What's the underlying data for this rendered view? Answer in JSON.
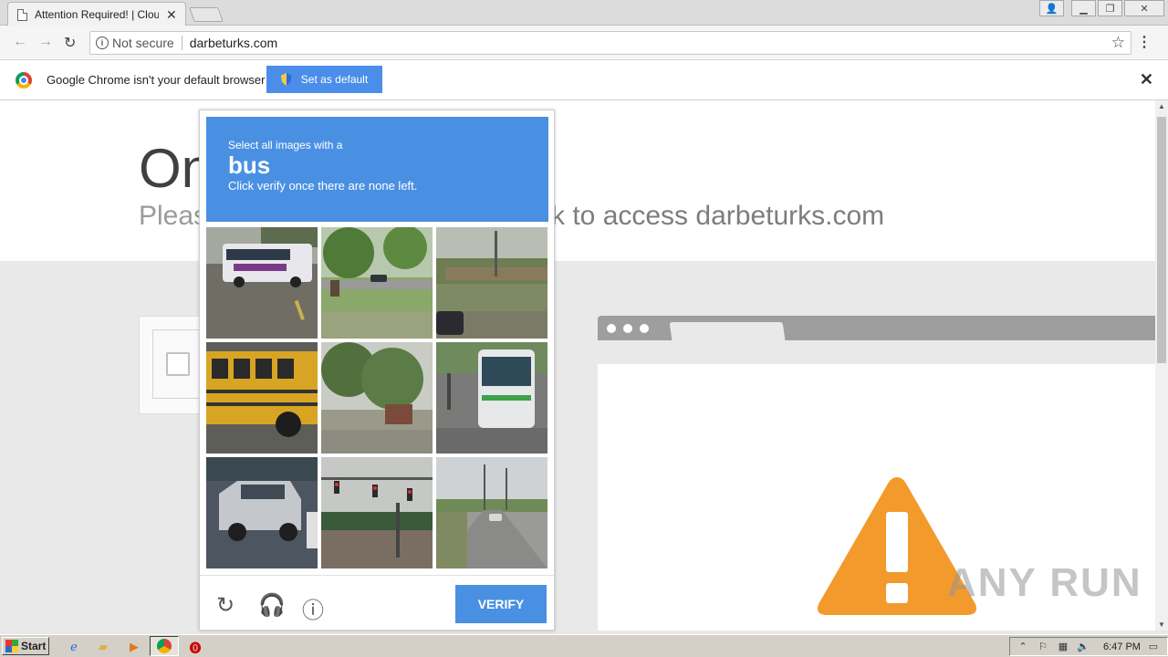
{
  "browser": {
    "tab_title": "Attention Required! | Cloudf",
    "security_label": "Not secure",
    "url": "darbeturks.com"
  },
  "infobar": {
    "message": "Google Chrome isn't your default browser",
    "button_label": "Set as default"
  },
  "page": {
    "heading": "On",
    "subheading_left": "Pleas",
    "subheading_right": "k to access darbeturks.com"
  },
  "captcha": {
    "instruction_line1": "Select all images with a",
    "target_word": "bus",
    "instruction_line3": "Click verify once there are none left.",
    "verify_label": "VERIFY",
    "tiles": [
      {
        "subject": "bus"
      },
      {
        "subject": "park-road"
      },
      {
        "subject": "street-fence"
      },
      {
        "subject": "school-bus"
      },
      {
        "subject": "trees"
      },
      {
        "subject": "bus"
      },
      {
        "subject": "suv"
      },
      {
        "subject": "traffic-lights"
      },
      {
        "subject": "highway"
      }
    ]
  },
  "watermark": "ANY RUN",
  "taskbar": {
    "start_label": "Start",
    "clock": "6:47 PM"
  },
  "colors": {
    "captcha_blue": "#4a90e2",
    "infobar_button": "#4a8eea",
    "warning_orange": "#f39a2c"
  }
}
